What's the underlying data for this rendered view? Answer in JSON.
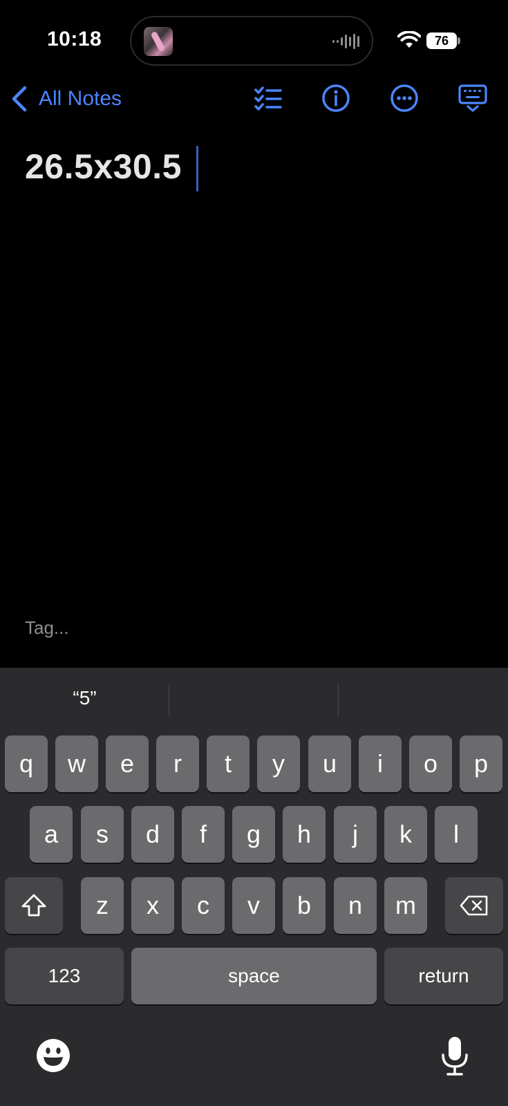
{
  "status_bar": {
    "time": "10:18",
    "battery_level": "76"
  },
  "nav": {
    "back_label": "All Notes",
    "icons": [
      "checklist-icon",
      "info-icon",
      "more-icon",
      "keyboard-dismiss-icon"
    ]
  },
  "note": {
    "body_text": "26.5x30.5",
    "tag_placeholder": "Tag..."
  },
  "keyboard": {
    "suggestions": [
      "“5”",
      "",
      ""
    ],
    "row1": [
      "q",
      "w",
      "e",
      "r",
      "t",
      "y",
      "u",
      "i",
      "o",
      "p"
    ],
    "row2": [
      "a",
      "s",
      "d",
      "f",
      "g",
      "h",
      "j",
      "k",
      "l"
    ],
    "row3": [
      "z",
      "x",
      "c",
      "v",
      "b",
      "n",
      "m"
    ],
    "numbers_label": "123",
    "space_label": "space",
    "return_label": "return"
  },
  "colors": {
    "accent": "#4c86ff",
    "background": "#000000",
    "keyboard_bg": "#2b2b2d",
    "key": "#6b6b6d",
    "special_key": "#464648"
  }
}
